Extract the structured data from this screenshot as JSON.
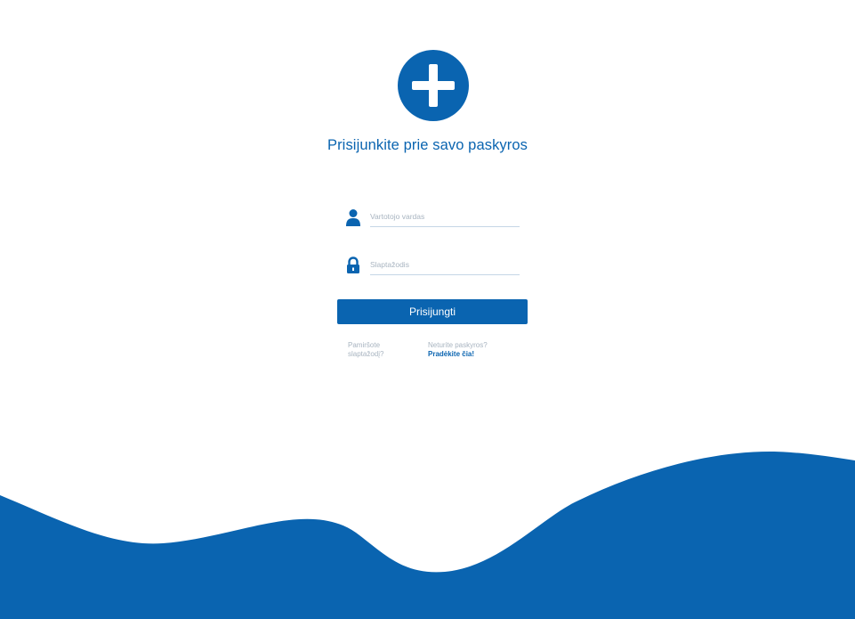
{
  "brand": {
    "accent_color": "#0a64b0",
    "logo_icon": "plus-circle-icon"
  },
  "login": {
    "title": "Prisijunkite prie savo paskyros",
    "username": {
      "icon": "user-icon",
      "placeholder": "Vartotojo vardas",
      "value": ""
    },
    "password": {
      "icon": "lock-icon",
      "placeholder": "Slaptažodis",
      "value": ""
    },
    "submit_label": "Prisijungti",
    "forgot_password": "Pamiršote slaptažodį?",
    "no_account": "Neturite paskyros?",
    "sign_up_link": "Pradėkite čia!"
  }
}
